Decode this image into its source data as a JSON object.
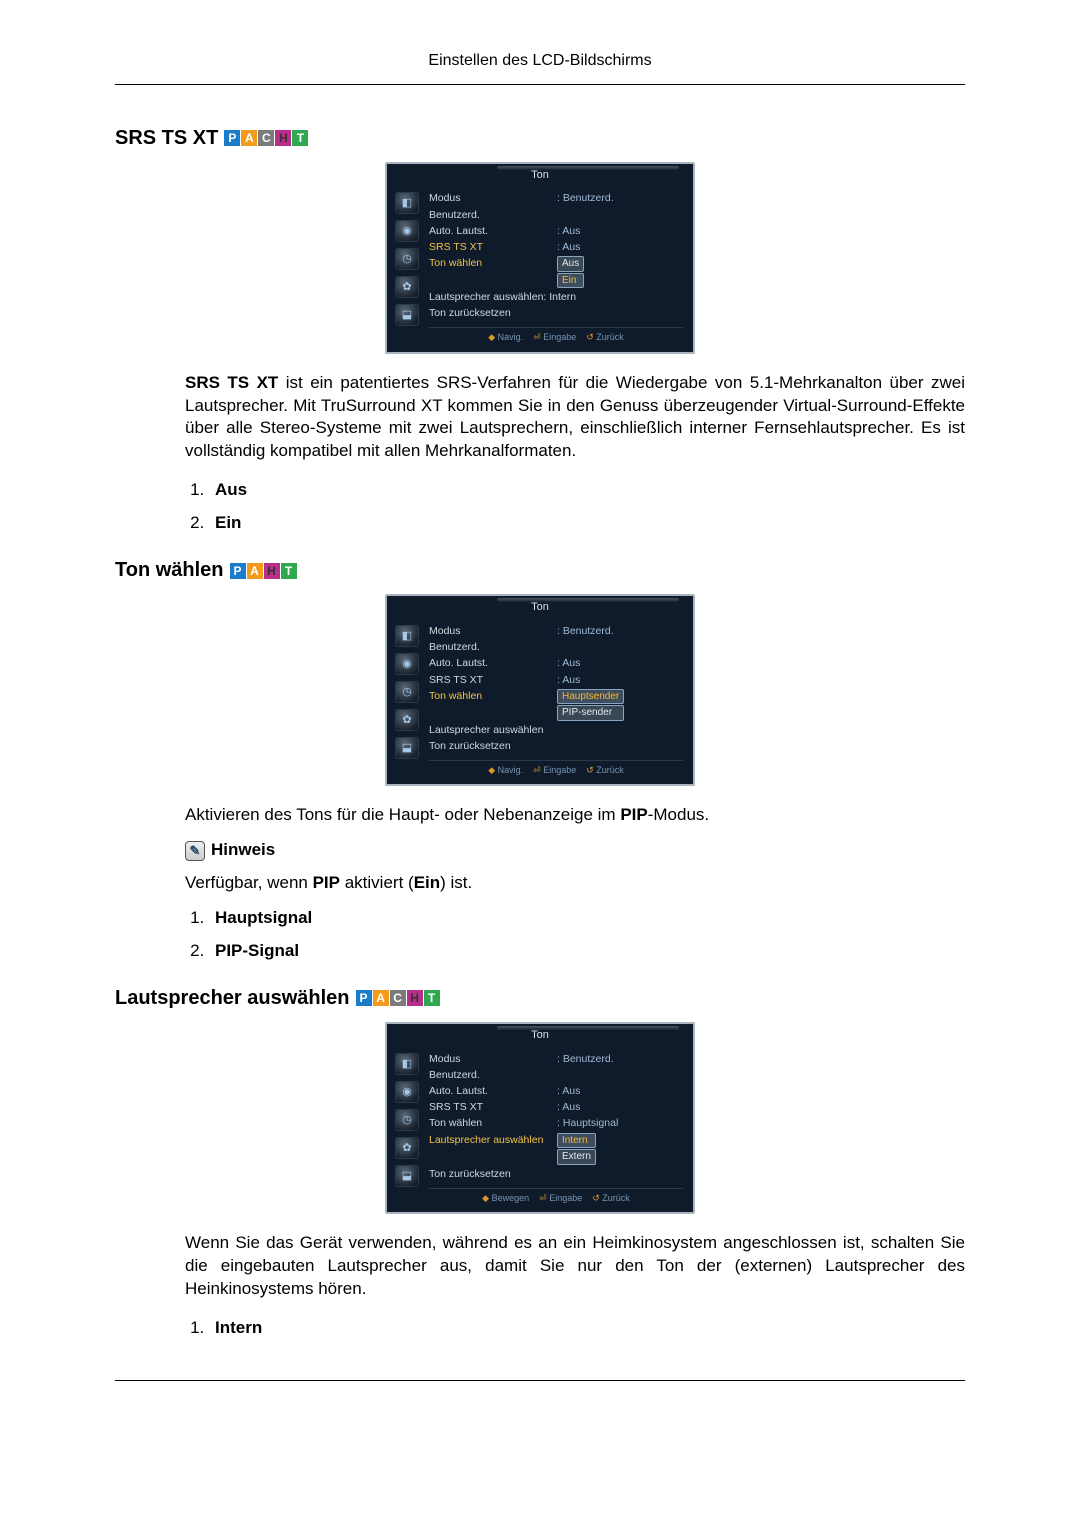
{
  "page_header": "Einstellen des LCD-Bildschirms",
  "sections": [
    {
      "title": "SRS TS XT",
      "badges": [
        "P",
        "A",
        "C",
        "H",
        "T"
      ],
      "osd": {
        "title": "Ton",
        "rows": [
          {
            "label": "Modus",
            "value": ": Benutzerd."
          },
          {
            "label": "Benutzerd.",
            "value": ""
          },
          {
            "label": "Auto. Lautst.",
            "value": ": Aus"
          },
          {
            "label": "SRS TS XT",
            "value": ": Aus",
            "hl": true
          },
          {
            "label": "Ton wählen",
            "value": "",
            "hl": true,
            "options_col": [
              "Aus",
              "Ein"
            ],
            "sel": 1
          },
          {
            "label": "Lautsprecher auswählen: Intern",
            "value": ""
          },
          {
            "label": "Ton zurücksetzen",
            "value": ""
          }
        ],
        "footer": [
          "Navig.",
          "Eingabe",
          "Zurück"
        ]
      },
      "body_html": "<b>SRS TS XT</b> ist ein patentiertes SRS-Verfahren für die Wiedergabe von 5.1-Mehrkanalton über zwei Lautsprecher. Mit TruSurround XT kommen Sie in den Genuss überzeugender Virtual-Surround-Effekte über alle Stereo-Systeme mit zwei Lautsprechern, einschließlich interner Fernsehlautsprecher. Es ist vollständig kompatibel mit allen Mehrkanalformaten.",
      "enum": [
        "Aus",
        "Ein"
      ]
    },
    {
      "title": "Ton wählen",
      "badges": [
        "P",
        "A",
        "H",
        "T"
      ],
      "osd": {
        "title": "Ton",
        "rows": [
          {
            "label": "Modus",
            "value": ": Benutzerd."
          },
          {
            "label": "Benutzerd.",
            "value": ""
          },
          {
            "label": "Auto. Lautst.",
            "value": ": Aus"
          },
          {
            "label": "SRS TS XT",
            "value": ": Aus"
          },
          {
            "label": "Ton wählen",
            "value": "",
            "hl": true,
            "options_col": [
              "Hauptsender",
              "PIP-sender"
            ],
            "sel": 0
          },
          {
            "label": "Lautsprecher auswählen",
            "value": ""
          },
          {
            "label": "Ton zurücksetzen",
            "value": ""
          }
        ],
        "footer": [
          "Navig.",
          "Eingabe",
          "Zurück"
        ]
      },
      "body_html": "Aktivieren des Tons für die Haupt- oder Nebenanzeige im <b>PIP</b>-Modus.",
      "note_label": "Hinweis",
      "note_body": "Verfügbar, wenn <b>PIP</b> aktiviert (<b>Ein</b>) ist.",
      "enum": [
        "Hauptsignal",
        "PIP-Signal"
      ]
    },
    {
      "title": "Lautsprecher auswählen",
      "badges": [
        "P",
        "A",
        "C",
        "H",
        "T"
      ],
      "osd": {
        "title": "Ton",
        "rows": [
          {
            "label": "Modus",
            "value": ": Benutzerd."
          },
          {
            "label": "Benutzerd.",
            "value": ""
          },
          {
            "label": "Auto. Lautst.",
            "value": ": Aus"
          },
          {
            "label": "SRS TS XT",
            "value": ": Aus"
          },
          {
            "label": "Ton wählen",
            "value": ": Hauptsignal"
          },
          {
            "label": "Lautsprecher auswählen",
            "value": "",
            "hl": true,
            "options_col": [
              "Intern",
              "Extern"
            ],
            "sel": 0
          },
          {
            "label": "Ton zurücksetzen",
            "value": ""
          }
        ],
        "footer": [
          "Bewegen",
          "Eingabe",
          "Zurück"
        ]
      },
      "body_html": "Wenn Sie das Gerät verwenden, während es an ein Heimkinosystem angeschlossen ist, schalten Sie die eingebauten Lautsprecher aus, damit Sie nur den Ton der (externen) Lautsprecher des Heinkinosystems hören.",
      "enum": [
        "Intern"
      ]
    }
  ]
}
